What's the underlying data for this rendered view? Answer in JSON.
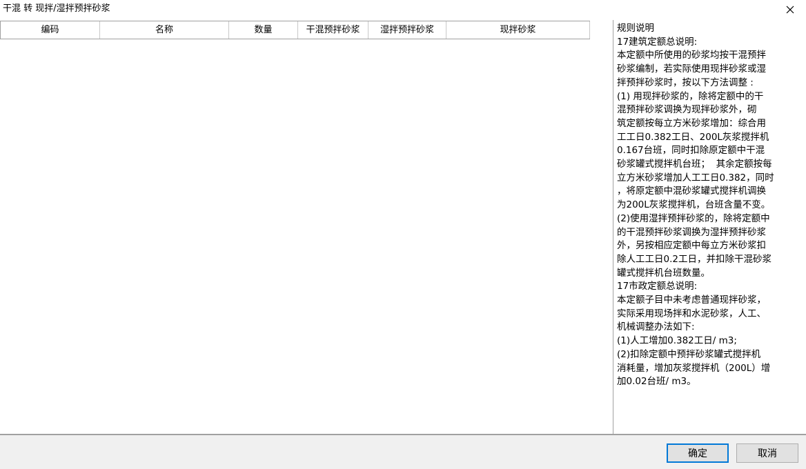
{
  "window": {
    "title": "干混 转 现拌/湿拌预拌砂浆"
  },
  "grid": {
    "columns": [
      "编码",
      "名称",
      "数量",
      "干混预拌砂浆",
      "湿拌预拌砂浆",
      "现拌砂浆"
    ]
  },
  "rules": {
    "lines": [
      "规则说明",
      "17建筑定额总说明:",
      "本定额中所使用的砂浆均按干混预拌",
      "砂浆编制，若实际使用现拌砂浆或湿",
      "拌预拌砂浆时，按以下方法调整 :",
      "(1) 用现拌砂浆的，除将定额中的干",
      "混预拌砂浆调换为现拌砂浆外，砌",
      "筑定额按每立方米砂浆增加：综合用",
      "工工日0.382工日、200L灰浆搅拌机",
      "0.167台班，同时扣除原定额中干混",
      "砂浆罐式搅拌机台班；  其余定额按每",
      "立方米砂浆增加人工工日0.382，同时",
      "，将原定额中混砂浆罐式搅拌机调换",
      "为200L灰浆搅拌机，台班含量不变。",
      "(2)使用湿拌预拌砂浆的，除将定额中",
      "的干混预拌砂浆调换为湿拌预拌砂浆",
      "外，另按相应定额中每立方米砂浆扣",
      "除人工工日0.2工日，并扣除干混砂浆",
      "罐式搅拌机台班数量。",
      "17市政定额总说明:",
      "本定额子目中未考虑普通现拌砂浆，",
      "实际采用现场拌和水泥砂浆，人工、",
      "机械调整办法如下:",
      "(1)人工增加0.382工日/ m3;",
      "(2)扣除定额中预拌砂浆罐式搅拌机",
      "消耗量，增加灰浆搅拌机（200L）增",
      "加0.02台班/ m3。"
    ]
  },
  "buttons": {
    "ok": "确定",
    "cancel": "取消"
  },
  "icons": {
    "close": "close-icon"
  }
}
